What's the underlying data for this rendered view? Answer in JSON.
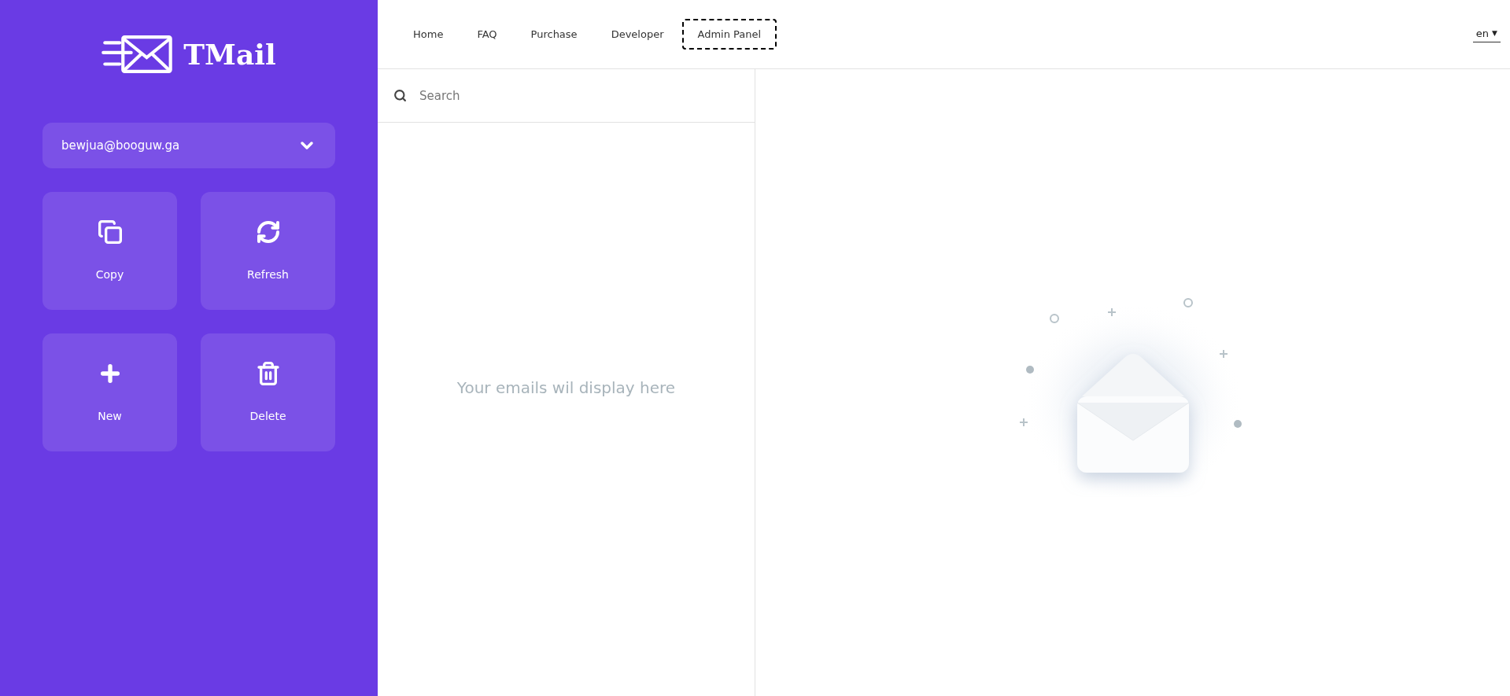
{
  "brand": {
    "name": "TMail"
  },
  "account": {
    "email": "bewjua@booguw.ga"
  },
  "actions": [
    {
      "kind": "copy",
      "label": "Copy"
    },
    {
      "kind": "refresh",
      "label": "Refresh"
    },
    {
      "kind": "new",
      "label": "New"
    },
    {
      "kind": "delete",
      "label": "Delete"
    }
  ],
  "nav": [
    {
      "label": "Home",
      "focused": false
    },
    {
      "label": "FAQ",
      "focused": false
    },
    {
      "label": "Purchase",
      "focused": false
    },
    {
      "label": "Developer",
      "focused": false
    },
    {
      "label": "Admin Panel",
      "focused": true
    }
  ],
  "language": {
    "value": "en",
    "arrow": "▼"
  },
  "search": {
    "placeholder": "Search"
  },
  "inbox": {
    "empty_message": "Your emails wil display here"
  }
}
